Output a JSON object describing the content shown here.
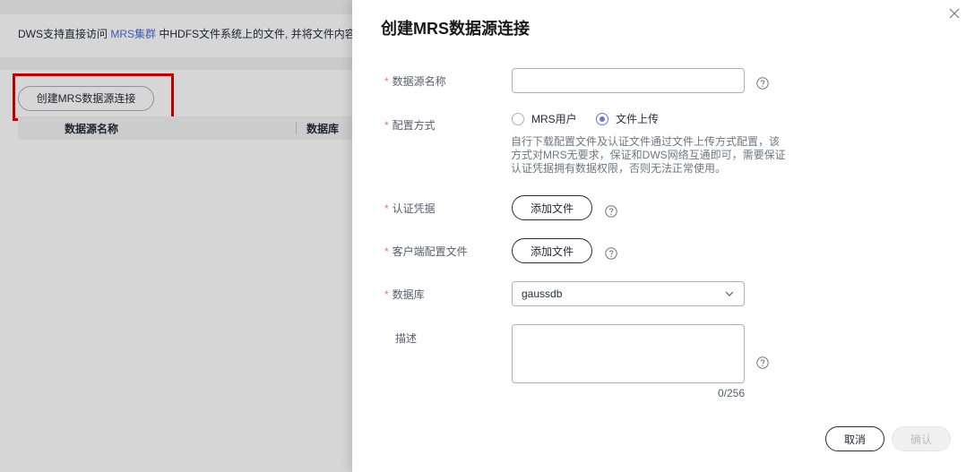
{
  "background": {
    "banner_prefix": "DWS支持直接访问",
    "banner_link": "MRS集群",
    "banner_suffix": "中HDFS文件系统上的文件, 并将文件内容",
    "create_button": "创建MRS数据源连接",
    "table_headers": [
      "数据源名称",
      "数据库"
    ]
  },
  "drawer": {
    "title": "创建MRS数据源连接",
    "fields": {
      "name_label": "数据源名称",
      "name_value": "",
      "config_label": "配置方式",
      "config_options": [
        "MRS用户",
        "文件上传"
      ],
      "config_selected": "文件上传",
      "config_hint": "自行下载配置文件及认证文件通过文件上传方式配置，该方式对MRS无要求，保证和DWS网络互通即可，需要保证认证凭据拥有数据权限，否则无法正常使用。",
      "credential_label": "认证凭据",
      "client_config_label": "客户端配置文件",
      "add_file_label": "添加文件",
      "database_label": "数据库",
      "database_value": "gaussdb",
      "desc_label": "描述",
      "desc_value": "",
      "desc_counter": "0/256"
    },
    "actions": {
      "cancel": "取消",
      "confirm": "确认"
    }
  },
  "colors": {
    "primary": "#5e7ce0",
    "link": "#526ecc",
    "required": "#f66f6a",
    "highlight": "#e00000"
  }
}
